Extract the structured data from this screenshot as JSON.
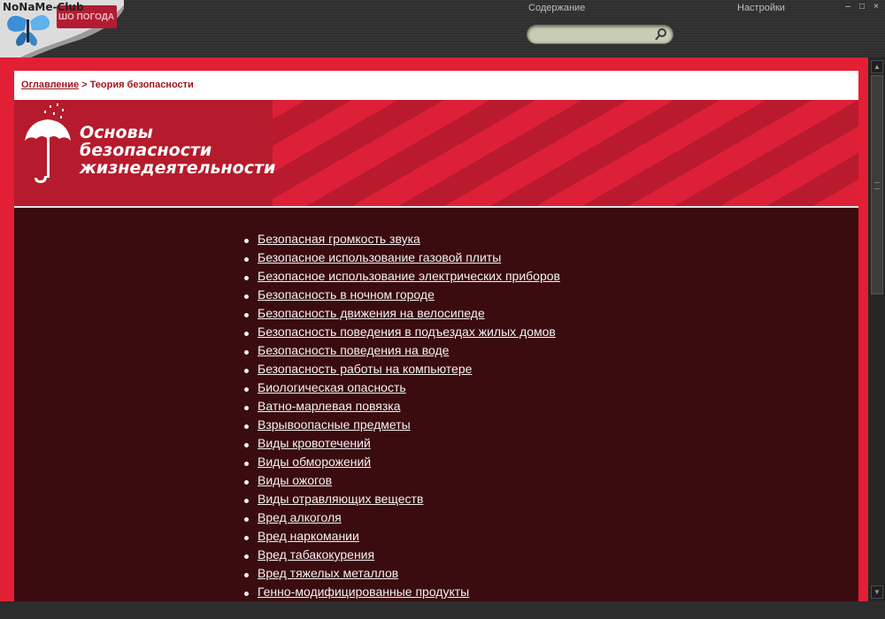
{
  "corner": {
    "label": "NoNaMe-Club",
    "tab_label": "ШО ПОГОДА"
  },
  "nav": {
    "contents": "Содержание",
    "settings": "Настройки"
  },
  "window_controls": {
    "minimize": "–",
    "maximize": "□",
    "close": "×"
  },
  "search": {
    "value": "",
    "placeholder": ""
  },
  "breadcrumb": {
    "root": "Оглавление",
    "separator": ">",
    "current": "Теория безопасности"
  },
  "banner": {
    "line1": "Основы",
    "line2": "безопасности",
    "line3": "жизнедеятельности"
  },
  "toc": {
    "items": [
      "Безопасная громкость звука",
      "Безопасное использование газовой плиты",
      "Безопасное использование электрических приборов",
      "Безопасность в ночном городе",
      "Безопасность движения на велосипеде",
      "Безопасность поведения в подъездах жилых домов",
      "Безопасность поведения на воде",
      "Безопасность работы на компьютере",
      "Биологическая опасность",
      "Ватно-марлевая повязка",
      "Взрывоопасные предметы",
      "Виды кровотечений",
      "Виды обморожений",
      "Виды ожогов",
      "Виды отравляющих веществ",
      "Вред алкоголя",
      "Вред наркомании",
      "Вред табакокурения",
      "Вред тяжелых металлов",
      "Генно-модифицированные продукты"
    ]
  },
  "colors": {
    "frame": "#e21f34",
    "content_bg": "#3a0b0f",
    "banner": "#b51b2c",
    "link": "#a0141e"
  }
}
